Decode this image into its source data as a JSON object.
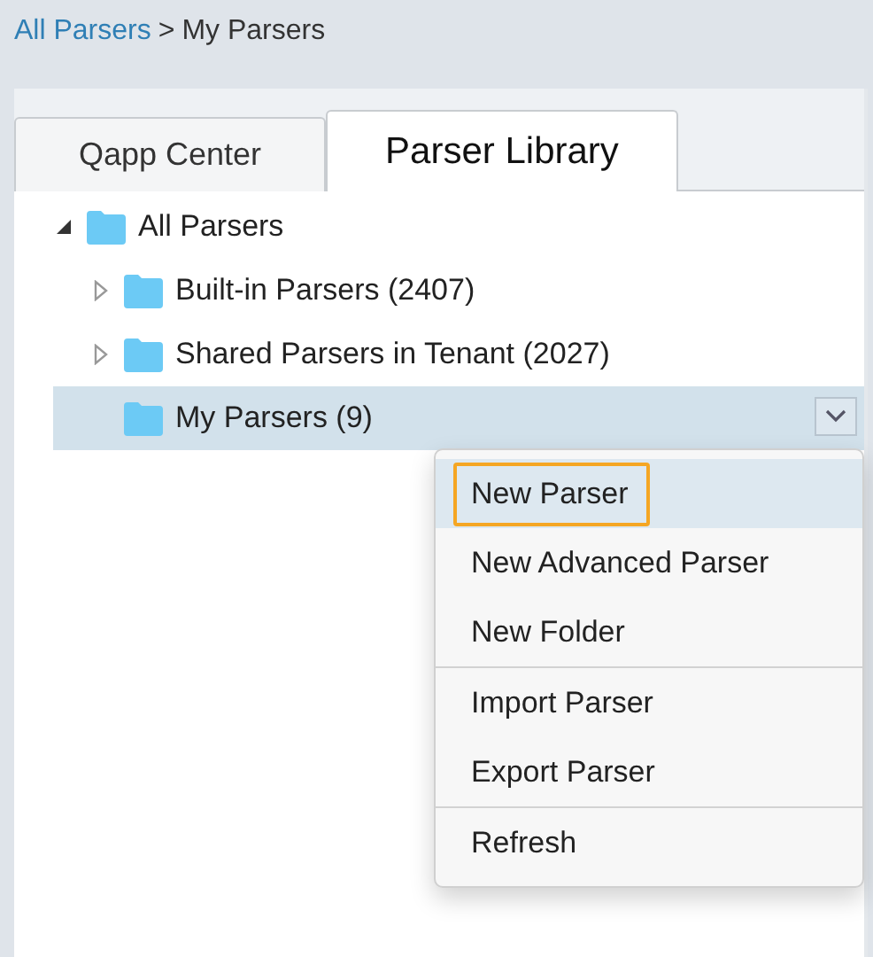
{
  "breadcrumb": {
    "link": "All Parsers",
    "separator": ">",
    "current": "My Parsers"
  },
  "tabs": [
    {
      "label": "Qapp Center",
      "selected": false
    },
    {
      "label": "Parser Library",
      "selected": true
    }
  ],
  "tree": [
    {
      "label": "All Parsers",
      "expanded": true,
      "selected": false,
      "children": [
        {
          "label": "Built-in Parsers (2407)",
          "expanded": false,
          "selected": false
        },
        {
          "label": "Shared Parsers in Tenant (2027)",
          "expanded": false,
          "selected": false
        },
        {
          "label": "My Parsers (9)",
          "selected": true
        }
      ]
    }
  ],
  "context_menu": {
    "groups": [
      [
        {
          "label": "New Parser",
          "selected": true
        },
        {
          "label": "New Advanced Parser",
          "selected": false
        },
        {
          "label": "New Folder",
          "selected": false
        }
      ],
      [
        {
          "label": "Import Parser",
          "selected": false
        },
        {
          "label": "Export Parser",
          "selected": false
        }
      ],
      [
        {
          "label": "Refresh",
          "selected": false
        }
      ]
    ]
  }
}
